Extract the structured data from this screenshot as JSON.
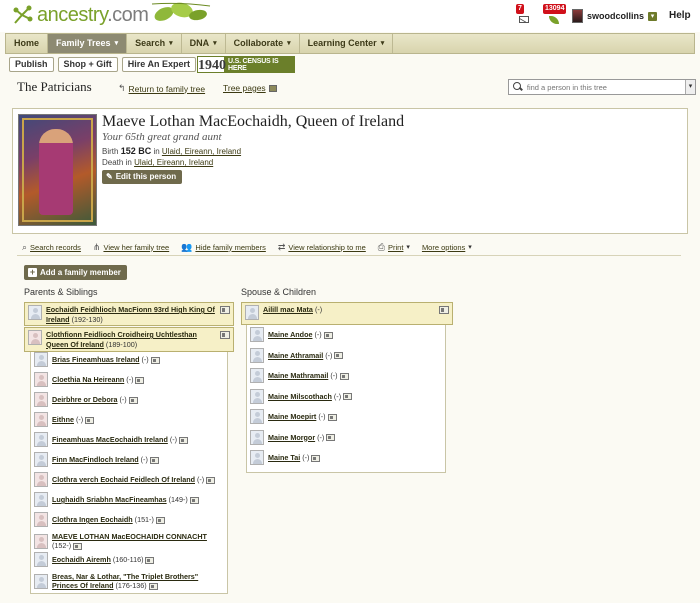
{
  "header": {
    "brand_prefix": "ancestry",
    "brand_suffix": ".com",
    "messages_count": "7",
    "hints_count": "13094",
    "username": "swoodcollins",
    "help_label": "Help"
  },
  "nav": {
    "items": [
      {
        "label": "Home",
        "caret": false,
        "active": false
      },
      {
        "label": "Family Trees",
        "caret": true,
        "active": true
      },
      {
        "label": "Search",
        "caret": true,
        "active": false
      },
      {
        "label": "DNA",
        "caret": true,
        "active": false
      },
      {
        "label": "Collaborate",
        "caret": true,
        "active": false
      },
      {
        "label": "Learning Center",
        "caret": true,
        "active": false
      }
    ]
  },
  "subbar": {
    "publish": "Publish",
    "shop": "Shop + Gift",
    "hire": "Hire An Expert",
    "census_year": "1940",
    "census_text": "U.S. CENSUS IS HERE"
  },
  "tree": {
    "title": "The Patricians",
    "return_link": "Return to family tree",
    "pages_link": "Tree pages",
    "search_placeholder": "find a person in this tree"
  },
  "person": {
    "name": "Maeve Lothan MacEochaidh, Queen of Ireland",
    "relationship": "Your 65th great grand aunt",
    "birth_label": "Birth",
    "birth_year": "152 BC",
    "in_word": "in",
    "birth_place": "Ulaid, Eireann, Ireland",
    "death_label": "Death",
    "death_place": "Ulaid, Eireann, Ireland",
    "edit_label": "Edit this person"
  },
  "actions": [
    {
      "label": "Search records",
      "icon": "search-records-icon"
    },
    {
      "label": "View her family tree",
      "icon": "family-tree-icon"
    },
    {
      "label": "Hide family members",
      "icon": "family-members-icon"
    },
    {
      "label": "View relationship to me",
      "icon": "relationship-icon"
    },
    {
      "label": "Print",
      "icon": "print-icon"
    },
    {
      "label": "More options",
      "icon": "chevron-down-icon"
    }
  ],
  "family": {
    "add_label": "Add a family member",
    "parents_heading": "Parents & Siblings",
    "spouse_heading": "Spouse & Children",
    "parents": [
      {
        "name": "Eochaidh Feidhlioch MacFionn 93rd High King Of Ireland",
        "dates": "(192-130)",
        "gender": "m"
      },
      {
        "name": "Clothfionn Feidlioch Croidheirg Uchtlesthan Queen Of Ireland",
        "dates": "(189-100)",
        "gender": "f"
      }
    ],
    "siblings": [
      {
        "name": "Brias Fineamhuas Ireland",
        "dates": "(-)",
        "gender": "m"
      },
      {
        "name": "Cloethia Na Heireann",
        "dates": "(-)",
        "gender": "f"
      },
      {
        "name": "Deirbhre or Debora",
        "dates": "(-)",
        "gender": "f"
      },
      {
        "name": "Eithne",
        "dates": "(-)",
        "gender": "f"
      },
      {
        "name": "Fineamhuas MacEochaidh Ireland",
        "dates": "(-)",
        "gender": "m"
      },
      {
        "name": "Finn MacFindloch Ireland",
        "dates": "(-)",
        "gender": "m"
      },
      {
        "name": "Clothra verch Eochaid Feidlech Of Ireland",
        "dates": "(-)",
        "gender": "f"
      },
      {
        "name": "Lughaidh Sriabhn MacFineamhas",
        "dates": "(149-)",
        "gender": "m"
      },
      {
        "name": "Clothra Ingen Eochaidh",
        "dates": "(151-)",
        "gender": "f"
      },
      {
        "name": "MAEVE LOTHAN MacEOCHAIDH CONNACHT",
        "dates": "(152-)",
        "gender": "f"
      },
      {
        "name": "Eochaidh Airemh",
        "dates": "(160-116)",
        "gender": "m"
      },
      {
        "name": "Breas, Nar & Lothar, \"The Triplet Brothers\" Princes Of Ireland",
        "dates": "(176-136)",
        "gender": "m"
      }
    ],
    "spouse": {
      "name": "Ailill mac Mata",
      "dates": "(-)",
      "gender": "m"
    },
    "children": [
      {
        "name": "Maine Andoe",
        "dates": "(-)",
        "gender": "m"
      },
      {
        "name": "Maine Athramail",
        "dates": "(-)",
        "gender": "m"
      },
      {
        "name": "Maine Mathramail",
        "dates": "(-)",
        "gender": "m"
      },
      {
        "name": "Maine Milscothach",
        "dates": "(-)",
        "gender": "m"
      },
      {
        "name": "Maine Moepirt",
        "dates": "(-)",
        "gender": "m"
      },
      {
        "name": "Maine Morgor",
        "dates": "(-)",
        "gender": "m"
      },
      {
        "name": "Maine Tai",
        "dates": "(-)",
        "gender": "m"
      }
    ]
  },
  "colors": {
    "accent_green": "#7aa12a",
    "button_brown": "#6f6a4c",
    "highlight_yellow": "#f6f0c7",
    "badge_red": "#d0101a"
  }
}
